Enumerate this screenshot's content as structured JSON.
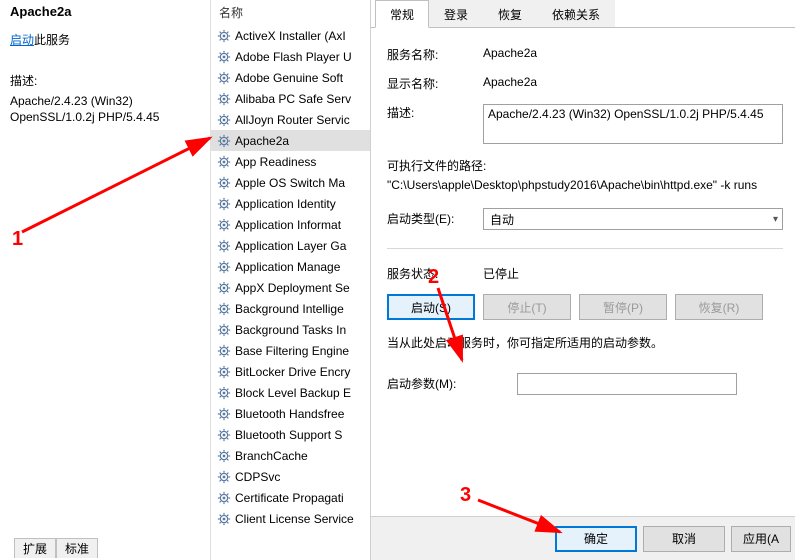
{
  "left": {
    "title": "Apache2a",
    "start_link": "启动",
    "start_suffix": "此服务",
    "describe_label": "描述:",
    "describe_text": "Apache/2.4.23 (Win32) OpenSSL/1.0.2j PHP/5.4.45"
  },
  "mid": {
    "header": "名称",
    "items": [
      "ActiveX Installer (AxI",
      "Adobe Flash Player U",
      "Adobe Genuine Soft",
      "Alibaba PC Safe Serv",
      "AllJoyn Router Servic",
      "Apache2a",
      "App Readiness",
      "Apple OS Switch Ma",
      "Application Identity",
      "Application Informat",
      "Application Layer Ga",
      "Application Manage",
      "AppX Deployment Se",
      "Background Intellige",
      "Background Tasks In",
      "Base Filtering Engine",
      "BitLocker Drive Encry",
      "Block Level Backup E",
      "Bluetooth Handsfree",
      "Bluetooth Support S",
      "BranchCache",
      "CDPSvc",
      "Certificate Propagati",
      "Client License Service"
    ],
    "selected_index": 5
  },
  "tabs": [
    "常规",
    "登录",
    "恢复",
    "依赖关系"
  ],
  "general": {
    "service_name_label": "服务名称:",
    "service_name_value": "Apache2a",
    "display_name_label": "显示名称:",
    "display_name_value": "Apache2a",
    "desc_label": "描述:",
    "desc_value": "Apache/2.4.23 (Win32) OpenSSL/1.0.2j PHP/5.4.45",
    "exe_path_label": "可执行文件的路径:",
    "exe_path_value": "\"C:\\Users\\apple\\Desktop\\phpstudy2016\\Apache\\bin\\httpd.exe\" -k runs",
    "startup_type_label": "启动类型(E):",
    "startup_type_value": "自动",
    "service_status_label": "服务状态:",
    "service_status_value": "已停止",
    "btn_start": "启动(S)",
    "btn_stop": "停止(T)",
    "btn_pause": "暂停(P)",
    "btn_resume": "恢复(R)",
    "hint": "当从此处启动服务时，你可指定所适用的启动参数。",
    "start_param_label": "启动参数(M):",
    "start_param_value": ""
  },
  "footer": {
    "ok": "确定",
    "cancel": "取消",
    "apply": "应用(A"
  },
  "bottom_tabs": [
    "扩展",
    "标准"
  ],
  "annotations": {
    "n1": "1",
    "n2": "2",
    "n3": "3"
  }
}
